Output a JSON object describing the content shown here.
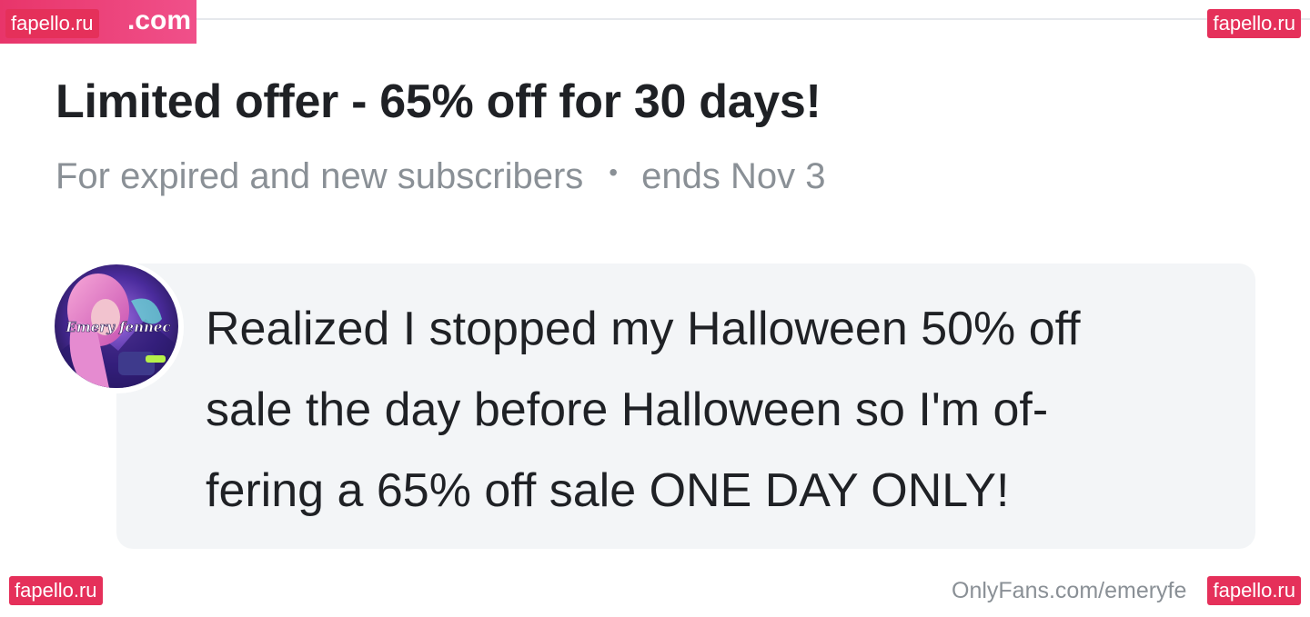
{
  "watermarks": {
    "brand_top_left": ".com",
    "top_left": "fapello.ru",
    "top_right": "fapello.ru",
    "bottom_left": "fapello.ru",
    "bottom_right": "fapello.ru",
    "color": "#e5305a"
  },
  "offer": {
    "title": "Limited offer - 65% off for 30 days!",
    "audience": "For expired and new subscribers",
    "separator": "•",
    "ends": "ends Nov 3"
  },
  "message": {
    "avatar_caption": "Emery fennec",
    "lines": [
      "Realized I stopped my Halloween 50% off",
      "sale the day before Halloween so I'm of-",
      "fering a 65% off sale ONE DAY ONLY!"
    ]
  },
  "footer": {
    "url": "OnlyFans.com/emeryfe"
  },
  "colors": {
    "title_text": "#1f2125",
    "muted_text": "#8a9096",
    "bubble_bg": "#f3f5f7",
    "divider": "#e6e8ec"
  }
}
